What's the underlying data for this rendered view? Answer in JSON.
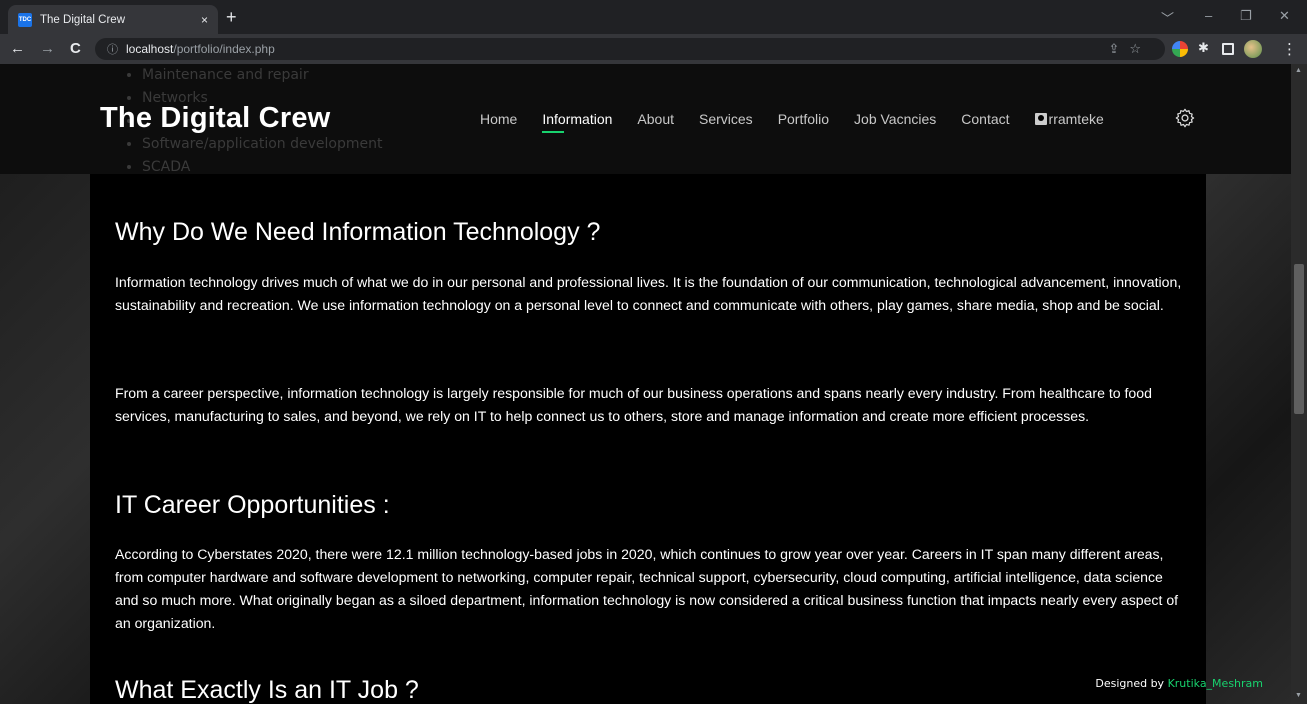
{
  "browser": {
    "tab_title": "The Digital Crew",
    "favicon_text": "TDC",
    "tab_close": "×",
    "new_tab": "+",
    "url_host": "localhost",
    "url_path": "/portfolio/index.php",
    "back_icon": "←",
    "forward_icon": "→",
    "reload_icon": "C",
    "info_icon": "ⓘ",
    "window_controls": {
      "chevron": "﹀",
      "minimize": "–",
      "restore": "❐",
      "close": "✕"
    },
    "menu_icon": "⋮"
  },
  "ghost_list": [
    "Maintenance and repair",
    "Networks",
    "",
    "Software/application development",
    "SCADA"
  ],
  "header": {
    "brand": "The Digital Crew",
    "nav": [
      "Home",
      "Information",
      "About",
      "Services",
      "Portfolio",
      "Job Vacncies",
      "Contact"
    ],
    "active_nav": "Information",
    "user": "rramteke"
  },
  "sections": {
    "why_title": "Why Do We Need Information Technology ?",
    "why_p1": "Information technology drives much of what we do in our personal and professional lives. It is the foundation of our communication, technological advancement, innovation, sustainability and recreation. We use information technology on a personal level to connect and communicate with others, play games, share media, shop and be social.",
    "why_p2": "From a career perspective, information technology is largely responsible for much of our business operations and spans nearly every industry. From healthcare to food services, manufacturing to sales, and beyond, we rely on IT to help connect us to others, store and manage information and create more efficient processes.",
    "career_title": "IT Career Opportunities :",
    "career_p1": "According to Cyberstates 2020, there were 12.1 million technology-based jobs in 2020, which continues to grow year over year. Careers in IT span many different areas, from computer hardware and software development to networking, computer repair, technical support, cybersecurity, cloud computing, artificial intelligence, data science and so much more. What originally began as a siloed department, information technology is now considered a critical business function that impacts nearly every aspect of an organization.",
    "job_title": "What Exactly Is an IT Job ?"
  },
  "footer": {
    "prefix": "Designed by",
    "author": "Krutika_Meshram"
  },
  "colors": {
    "accent": "#18d26e",
    "background": "#000000",
    "chrome": "#202124"
  }
}
